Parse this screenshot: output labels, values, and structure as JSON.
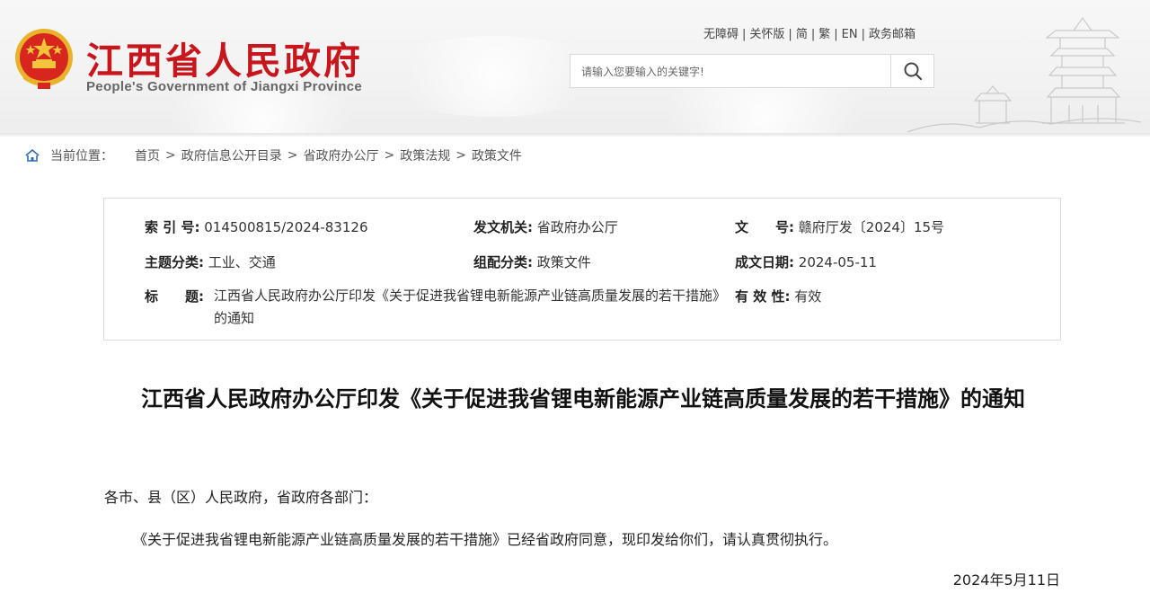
{
  "header": {
    "site_title": "江西省人民政府",
    "site_subtitle": "People's Government of Jiangxi Province",
    "top_links": [
      "无障碍",
      "关怀版",
      "简",
      "繁",
      "EN",
      "政务邮箱"
    ],
    "search_placeholder": "请输入您要输入的关键字!",
    "brand_color": "#c8161d"
  },
  "breadcrumb": {
    "location_label": "当前位置：",
    "items": [
      "首页",
      "政府信息公开目录",
      "省政府办公厅",
      "政策法规",
      "政策文件"
    ],
    "separator": ">"
  },
  "info": {
    "index_label": "索 引 号:",
    "index_value": "014500815/2024-83126",
    "issuer_label": "发文机关:",
    "issuer_value": "省政府办公厅",
    "docno_label": "文　　号:",
    "docno_value": "赣府厅发〔2024〕15号",
    "topic_label": "主题分类:",
    "topic_value": "工业、交通",
    "category_label": "组配分类:",
    "category_value": "政策文件",
    "date_label": "成文日期:",
    "date_value": "2024-05-11",
    "title_label": "标　　题:",
    "title_value": "江西省人民政府办公厅印发《关于促进我省锂电新能源产业链高质量发展的若干措施》的通知",
    "validity_label": "有 效 性:",
    "validity_value": "有效"
  },
  "article": {
    "title": "江西省人民政府办公厅印发《关于促进我省锂电新能源产业链高质量发展的若干措施》的通知",
    "greeting": "各市、县（区）人民政府，省政府各部门：",
    "body": "《关于促进我省锂电新能源产业链高质量发展的若干措施》已经省政府同意，现印发给你们，请认真贯彻执行。",
    "date": "2024年5月11日"
  }
}
